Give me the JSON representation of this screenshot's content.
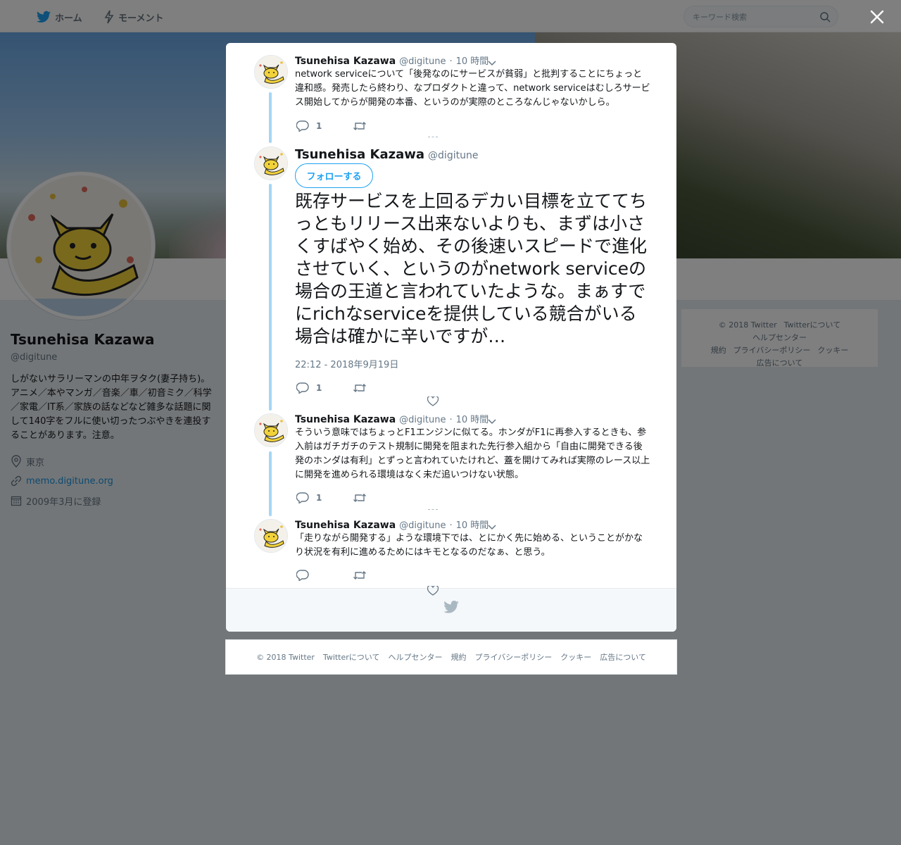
{
  "nav": {
    "home_label": "ホーム",
    "moments_label": "モーメント",
    "search_placeholder": "キーワード検索"
  },
  "profile": {
    "name": "Tsunehisa Kazawa",
    "handle": "@digitune",
    "bio": "しがないサラリーマンの中年ヲタク(妻子持ち)。アニメ／本やマンガ／音楽／車／初音ミク／科学／家電／IT系／家族の話などなど雑多な話題に関して140字をフルに使い切ったつぶやきを連投することがあります。注意。",
    "location": "東京",
    "url": "memo.digitune.org",
    "joined": "2009年3月に登録"
  },
  "side_footer": {
    "links": [
      "© 2018 Twitter",
      "Twitterについて",
      "ヘルプセンター",
      "規約",
      "プライバシーポリシー",
      "クッキー",
      "広告について"
    ]
  },
  "modal": {
    "tweets": [
      {
        "name": "Tsunehisa Kazawa",
        "handle": "@digitune",
        "time": "10 時間",
        "text": "network serviceについて「後発なのにサービスが貧弱」と批判することにちょっと違和感。発売したら終わり、なプロダクトと違って、network serviceはむしろサービス開始してからが開発の本番、というのが実際のところなんじゃないかしら。",
        "reply_count": "1"
      },
      {
        "name": "Tsunehisa Kazawa",
        "handle": "@digitune",
        "time": "10 時間",
        "text": "そういう意味ではちょっとF1エンジンに似てる。ホンダがF1に再参入するときも、参入前はガチガチのテスト規制に開発を阻まれた先行参入組から「自由に開発できる後発のホンダは有利」とずっと言われていたけれど、蓋を開けてみれば実際のレース以上に開発を進められる環境はなく未だ追いつけない状態。",
        "reply_count": "1"
      },
      {
        "name": "Tsunehisa Kazawa",
        "handle": "@digitune",
        "time": "10 時間",
        "text": "「走りながら開発する」ような環境下では、とにかく先に始める、ということがかなり状況を有利に進めるためにはキモとなるのだなぁ、と思う。",
        "reply_count": ""
      }
    ],
    "main_tweet": {
      "name": "Tsunehisa Kazawa",
      "handle": "@digitune",
      "follow_label": "フォローする",
      "text": "既存サービスを上回るデカい目標を立ててちっともリリース出来ないよりも、まずは小さくすばやく始め、その後速いスピードで進化させていく、というのがnetwork serviceの場合の王道と言われていたような。まぁすでにrichなserviceを提供している競合がいる場合は確かに辛いですが…",
      "date": "22:12 - 2018年9月19日",
      "reply_count": "1"
    }
  },
  "footer": {
    "links": [
      "© 2018 Twitter",
      "Twitterについて",
      "ヘルプセンター",
      "規約",
      "プライバシーポリシー",
      "クッキー",
      "広告について"
    ]
  },
  "colors": {
    "accent": "#1da1f2",
    "thread_line": "#a5d6f4",
    "overlay": "rgba(0,0,0,0.5)"
  }
}
